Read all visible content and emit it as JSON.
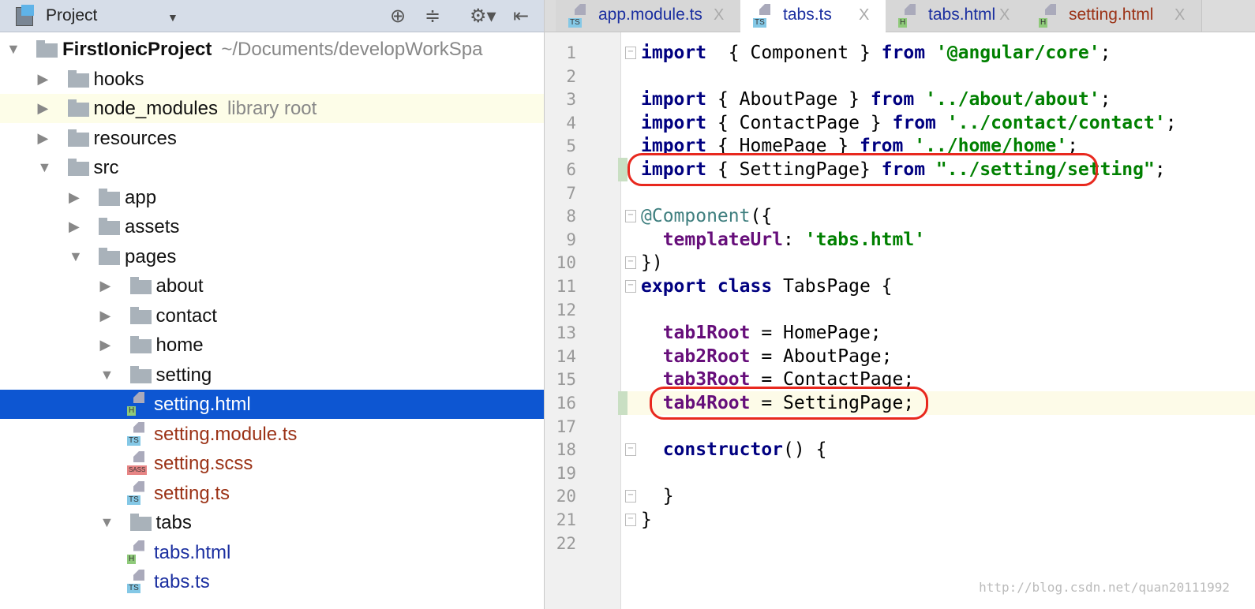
{
  "project_panel": {
    "title": "Project",
    "icons": [
      "locate-icon",
      "collapse-all-icon",
      "gear-icon",
      "hide-panel-icon"
    ]
  },
  "tree": [
    {
      "label": "FirstIonicProject",
      "hint": "~/Documents/developWorkSpa",
      "depth": 0,
      "kind": "folder",
      "expanded": true,
      "bold": true
    },
    {
      "label": "hooks",
      "depth": 1,
      "kind": "folder",
      "expanded": false
    },
    {
      "label": "node_modules",
      "hint": "library root",
      "depth": 1,
      "kind": "folder",
      "expanded": false,
      "library": true
    },
    {
      "label": "resources",
      "depth": 1,
      "kind": "folder",
      "expanded": false
    },
    {
      "label": "src",
      "depth": 1,
      "kind": "folder",
      "expanded": true
    },
    {
      "label": "app",
      "depth": 2,
      "kind": "folder",
      "expanded": false
    },
    {
      "label": "assets",
      "depth": 2,
      "kind": "folder",
      "expanded": false
    },
    {
      "label": "pages",
      "depth": 2,
      "kind": "folder",
      "expanded": true
    },
    {
      "label": "about",
      "depth": 3,
      "kind": "folder",
      "expanded": false
    },
    {
      "label": "contact",
      "depth": 3,
      "kind": "folder",
      "expanded": false
    },
    {
      "label": "home",
      "depth": 3,
      "kind": "folder",
      "expanded": false
    },
    {
      "label": "setting",
      "depth": 3,
      "kind": "folder",
      "expanded": true
    },
    {
      "label": "setting.html",
      "depth": 4,
      "kind": "file",
      "badge": "H",
      "selected": true,
      "color": "#9b3216"
    },
    {
      "label": "setting.module.ts",
      "depth": 4,
      "kind": "file",
      "badge": "TS",
      "color": "#9b3216"
    },
    {
      "label": "setting.scss",
      "depth": 4,
      "kind": "file",
      "badge": "SASS",
      "color": "#9b3216"
    },
    {
      "label": "setting.ts",
      "depth": 4,
      "kind": "file",
      "badge": "TS",
      "color": "#9b3216"
    },
    {
      "label": "tabs",
      "depth": 3,
      "kind": "folder",
      "expanded": true
    },
    {
      "label": "tabs.html",
      "depth": 4,
      "kind": "file",
      "badge": "H",
      "color": "#1b2fa0"
    },
    {
      "label": "tabs.ts",
      "depth": 4,
      "kind": "file",
      "badge": "TS",
      "color": "#1b2fa0"
    }
  ],
  "badge_colors": {
    "H": "#8fca7a",
    "TS": "#84c8e6",
    "SASS": "#e78585"
  },
  "editor_tabs": [
    {
      "label": "app.module.ts",
      "badge": "TS",
      "color": "#1b2fa0"
    },
    {
      "label": "tabs.ts",
      "badge": "TS",
      "color": "#1b2fa0",
      "active": true
    },
    {
      "label": "tabs.html",
      "badge": "H",
      "color": "#1b2fa0"
    },
    {
      "label": "setting.html",
      "badge": "H",
      "color": "#9b3216"
    }
  ],
  "close_glyph": "X",
  "code": [
    [
      [
        "kw",
        "import"
      ],
      [
        "",
        "  { Component } "
      ],
      [
        "kw",
        "from"
      ],
      [
        "",
        " "
      ],
      [
        "str",
        "'@angular/core'"
      ],
      [
        "",
        ";"
      ]
    ],
    [],
    [
      [
        "kw",
        "import"
      ],
      [
        "",
        " { AboutPage } "
      ],
      [
        "kw",
        "from"
      ],
      [
        "",
        " "
      ],
      [
        "str",
        "'../about/about'"
      ],
      [
        "",
        ";"
      ]
    ],
    [
      [
        "kw",
        "import"
      ],
      [
        "",
        " { ContactPage } "
      ],
      [
        "kw",
        "from"
      ],
      [
        "",
        " "
      ],
      [
        "str",
        "'../contact/contact'"
      ],
      [
        "",
        ";"
      ]
    ],
    [
      [
        "kw",
        "import"
      ],
      [
        "",
        " { HomePage } "
      ],
      [
        "kw",
        "from"
      ],
      [
        "",
        " "
      ],
      [
        "str",
        "'../home/home'"
      ],
      [
        "",
        ";"
      ]
    ],
    [
      [
        "kw",
        "import"
      ],
      [
        "",
        " { SettingPage} "
      ],
      [
        "kw",
        "from"
      ],
      [
        "",
        " "
      ],
      [
        "str",
        "\"../setting/setting\""
      ],
      [
        "",
        ";"
      ]
    ],
    [],
    [
      [
        "dec",
        "@Component"
      ],
      [
        "",
        "({"
      ]
    ],
    [
      [
        "",
        "  "
      ],
      [
        "fld",
        "templateUrl"
      ],
      [
        "",
        ": "
      ],
      [
        "str",
        "'tabs.html'"
      ]
    ],
    [
      [
        "",
        "})"
      ]
    ],
    [
      [
        "kw",
        "export class"
      ],
      [
        "",
        " TabsPage {"
      ]
    ],
    [],
    [
      [
        "",
        "  "
      ],
      [
        "fld",
        "tab1Root"
      ],
      [
        "",
        " = HomePage;"
      ]
    ],
    [
      [
        "",
        "  "
      ],
      [
        "fld",
        "tab2Root"
      ],
      [
        "",
        " = AboutPage;"
      ]
    ],
    [
      [
        "",
        "  "
      ],
      [
        "fld",
        "tab3Root"
      ],
      [
        "",
        " = ContactPage;"
      ]
    ],
    [
      [
        "",
        "  "
      ],
      [
        "fld",
        "tab4Root"
      ],
      [
        "",
        " = SettingPage;"
      ]
    ],
    [],
    [
      [
        "",
        "  "
      ],
      [
        "kw",
        "constructor"
      ],
      [
        "",
        "() {"
      ]
    ],
    [],
    [
      [
        "",
        "  }"
      ]
    ],
    [
      [
        "",
        "}"
      ]
    ],
    []
  ],
  "current_line": 16,
  "changed_lines": [
    6,
    16
  ],
  "highlighted_lines": [
    6,
    16
  ],
  "watermark": "http://blog.csdn.net/quan20111992"
}
